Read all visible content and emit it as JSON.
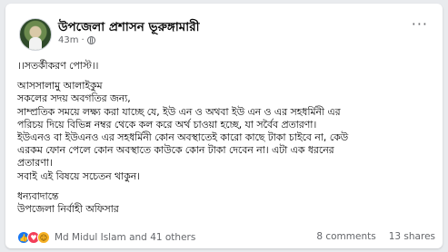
{
  "post": {
    "page_name": "উপজেলা প্রশাসন ভূরুঙ্গামারী",
    "time": "43m",
    "privacy_icon": "globe-icon",
    "more_icon": "more-options-icon",
    "lines": [
      "।।সতর্কীকরণ পোস্ট।।",
      "আসসালামু আলাইকুম",
      "সকলের সদয় অবগতির জন্য,",
      "সাম্প্রতিক সময়ে লক্ষ্য করা যাচ্ছে যে, ইউ এন ও অথবা ইউ এন ও এর সহধর্মিনী এর",
      "পরিচয় দিয়ে বিভিন্ন নম্বর থেকে কল করে অর্থ চাওয়া হচ্ছে, যা সর্বৈব প্রতারণা।",
      "ইউএনও বা ইউএনও এর সহধর্মিনী কোন অবস্থাতেই কারো কাছে টাকা চাইবে না, কেউ",
      "এরকম ফোন পেলে কোন অবস্থাতে কাউকে কোন টাকা দেবেন না। এটা এক ধরনের",
      "প্রতারণা।",
      "সবাই এই বিষয়ে সচেতন থাকুন।",
      "ধন্যবাদান্তে",
      "উপজেলা নির্বাহী অফিসার"
    ]
  },
  "footer": {
    "reactions_text": "Md Midul Islam and 41 others",
    "comments": "8 comments",
    "shares": "13 shares",
    "reaction_icons": [
      "like-icon",
      "love-icon",
      "haha-icon"
    ]
  },
  "colors": {
    "like": "#1877f2",
    "love": "#f33e58",
    "haha": "#f7b125",
    "secondary_text": "#65676b"
  }
}
